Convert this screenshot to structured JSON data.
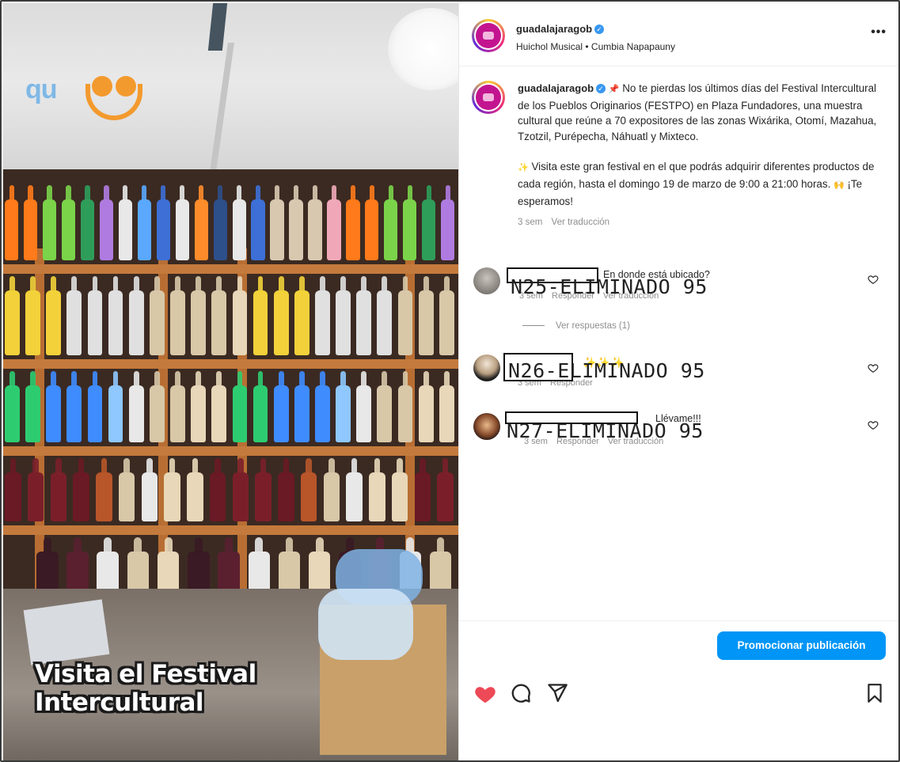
{
  "media": {
    "caption_overlay": "Visita el Festival Intercultural",
    "logo_text": "qu"
  },
  "post": {
    "username": "guadalajaragob",
    "audio": "Huichol Musical • Cumbia Napapauny",
    "more_icon": "more-horizontal-icon",
    "caption": {
      "username": "guadalajaragob",
      "pin_emoji": "📌",
      "paragraph1": "No te pierdas los últimos días del Festival Intercultural de los Pueblos Originarios (FESTPO) en Plaza Fundadores, una muestra cultural que reúne a 70 expositores de las zonas Wixárika, Otomí, Mazahua, Tzotzil, Purépecha, Náhuatl y Mixteco.",
      "sparkle_emoji": "✨",
      "paragraph2": "Visita este gran festival en el que podrás adquirir diferentes productos de cada región, hasta el domingo 19 de marzo de 9:00 a 21:00 horas.",
      "hands_emoji": "🙌",
      "paragraph2_end": "¡Te esperamos!",
      "time": "3 sem",
      "translate": "Ver traducción"
    }
  },
  "comments": [
    {
      "redaction": "N25-ELIMINADO 95",
      "text": "En donde está ubicado?",
      "time": "3 sem",
      "reply": "Responder",
      "translate": "Ver traducción",
      "view_replies": "Ver respuestas (1)"
    },
    {
      "redaction": "N26-ELIMINADO 95",
      "text": "✨✨✨",
      "time": "3 sem",
      "reply": "Responder"
    },
    {
      "redaction": "N27-ELIMINADO 95",
      "text": "Llévame!!!",
      "time": "3 sem",
      "reply": "Responder",
      "translate": "Ver traducción"
    }
  ],
  "promote_button": "Promocionar publicación",
  "colors": {
    "accent": "#0095f6",
    "like": "#ed4956",
    "verified": "#3897f0"
  }
}
